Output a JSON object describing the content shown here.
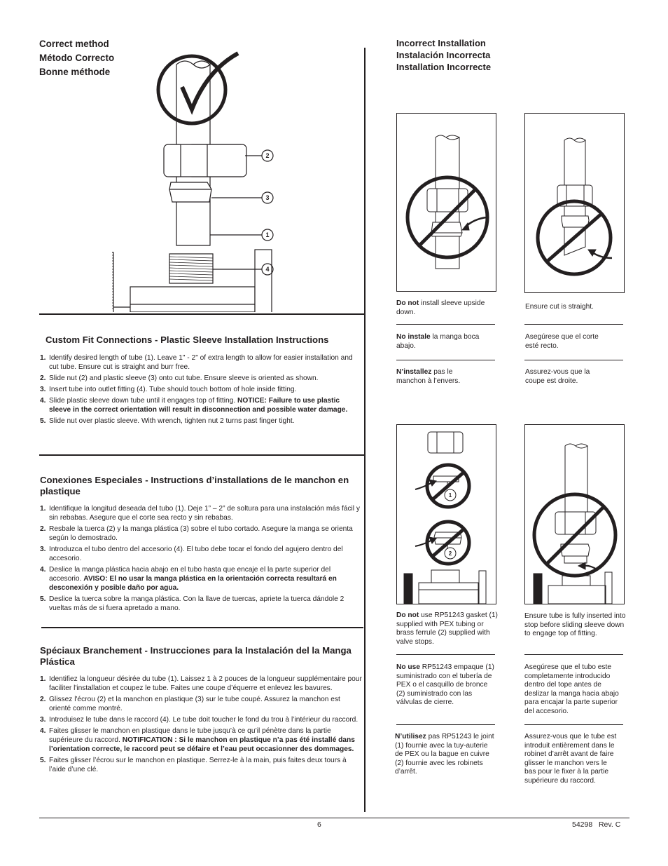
{
  "correct": {
    "headings": [
      "Correct method",
      "Método Correcto",
      "Bonne méthode"
    ],
    "callouts": [
      "2",
      "3",
      "1",
      "4"
    ]
  },
  "incorrect": {
    "headings": [
      "Incorrect Installation",
      "Instalación Incorrecta",
      "Installation Incorrecte"
    ],
    "panels": [
      {
        "captions": [
          {
            "bold": "Do not",
            "text": " install sleeve upside down."
          },
          {
            "bold": "No instale",
            "text": " la manga boca abajo."
          },
          {
            "bold": "N’installez",
            "text": " pas le manchon à l’envers."
          }
        ]
      },
      {
        "captions": [
          {
            "bold": "",
            "text": "Ensure cut is straight."
          },
          {
            "bold": "",
            "text": "Asegúrese que el corte esté recto."
          },
          {
            "bold": "",
            "text": "Assurez-vous que la coupe est droite."
          }
        ]
      },
      {
        "callouts": [
          "1",
          "2"
        ],
        "captions": [
          {
            "bold": "Do not",
            "text": " use RP51243 gasket (1) supplied with PEX tubing or brass ferrule (2) supplied with valve stops."
          },
          {
            "bold": "No use",
            "text": " RP51243 empaque (1) suministrado con el tubería de PEX o el casquillo de bronce (2) suministrado con las válvulas de cierre."
          },
          {
            "bold": "N’utilisez",
            "text": " pas RP51243 le joint (1) fournie avec la tuy-auterie de PEX ou la bague en cuivre (2) fournie avec les robinets d’arrêt."
          }
        ]
      },
      {
        "captions": [
          {
            "bold": "",
            "text": "Ensure tube is fully inserted into stop before sliding sleeve down to engage top of fitting."
          },
          {
            "bold": "",
            "text": "Asegúrese que el tubo este completamente introducido dentro del tope antes de deslizar la manga hacia abajo para encajar la parte superior del accesorio."
          },
          {
            "bold": "",
            "text": "Assurez-vous que le tube est introduit entièrement dans le robinet d’arrêt avant de faire glisser le manchon vers le bas pour le fixer à la partie supérieure du raccord."
          }
        ]
      }
    ]
  },
  "sections": [
    {
      "title": "Custom Fit Connections - Plastic Sleeve Installation Instructions",
      "steps": [
        {
          "num": "1.",
          "text": "Identify desired length of tube (1). Leave 1\" - 2\" of extra length to allow for easier installation and cut tube. Ensure cut is straight and burr free.",
          "bold": ""
        },
        {
          "num": "2.",
          "text": "Slide nut (2) and plastic sleeve (3) onto cut tube. Ensure sleeve is oriented as shown.",
          "bold": ""
        },
        {
          "num": "3.",
          "text": "Insert tube into outlet fitting (4). Tube should touch bottom of hole inside fitting.",
          "bold": ""
        },
        {
          "num": "4.",
          "text": "Slide plastic sleeve down tube until it engages top of fitting. ",
          "bold": "NOTICE: Failure to use plastic sleeve in the correct orientation will result in disconnection and possible water damage."
        },
        {
          "num": "5.",
          "text": "Slide nut over plastic sleeve. With wrench, tighten nut 2 turns past finger tight.",
          "bold": ""
        }
      ]
    },
    {
      "title": "Conexiones Especiales - Instructions d’installations de le manchon en plastique",
      "steps": [
        {
          "num": "1.",
          "text": "Identifique la longitud deseada del tubo (1). Deje 1” – 2” de soltura para una instalación más fácil y sin rebabas. Asegure que el corte sea recto y sin rebabas.",
          "bold": ""
        },
        {
          "num": "2.",
          "text": "Resbale la tuerca (2) y la manga plástica (3) sobre el tubo cortado. Asegure la manga se orienta según lo demostrado.",
          "bold": ""
        },
        {
          "num": "3.",
          "text": "Introduzca el tubo dentro del accesorio (4). El tubo debe tocar el fondo del agujero dentro del accesorio.",
          "bold": ""
        },
        {
          "num": "4.",
          "text": "Deslice la manga plástica hacia abajo en el tubo hasta que encaje el la parte superior del accesorio. ",
          "bold": "AVISO: El no usar la manga plástica en la orientación correcta resultará en desconexión y posible daño por agua."
        },
        {
          "num": "5.",
          "text": "Deslice la tuerca sobre la manga plástica. Con la llave de tuercas, apriete la tuerca dándole 2 vueltas más de si fuera apretado a mano.",
          "bold": ""
        }
      ]
    },
    {
      "title": "Spéciaux Branchement - Instrucciones para la Instalación del la Manga Plástica",
      "steps": [
        {
          "num": "1.",
          "text": "Identifiez la longueur désirée du tube (1). Laissez 1 à 2 pouces de la longueur supplémentaire pour faciliter l'installation et coupez le tube. Faites une coupe d’équerre et enlevez les bavures.",
          "bold": ""
        },
        {
          "num": "2.",
          "text": "Glissez l'écrou (2) et la manchon en plastique (3) sur le tube coupé. Assurez la manchon est orienté comme montré.",
          "bold": ""
        },
        {
          "num": "3.",
          "text": "Introduisez le tube dans le raccord (4). Le tube doit toucher le fond du trou à l’intérieur du raccord.",
          "bold": ""
        },
        {
          "num": "4.",
          "text": "Faites glisser le manchon en plastique dans le tube jusqu’à ce qu’il pénètre dans la partie supérieure du raccord. ",
          "bold": "NOTIFICATION : Si le manchon en plastique n’a pas été installé dans l’orientation correcte, le raccord peut se défaire et l’eau peut occasionner des dommages."
        },
        {
          "num": "5.",
          "text": "Faites glisser l’écrou sur le manchon en plastique. Serrez-le à la main, puis faites deux tours à l’aide d’une clé.",
          "bold": ""
        }
      ]
    }
  ],
  "footer": {
    "page_number": "6",
    "doc_id": "54298",
    "revision": "Rev. C"
  }
}
